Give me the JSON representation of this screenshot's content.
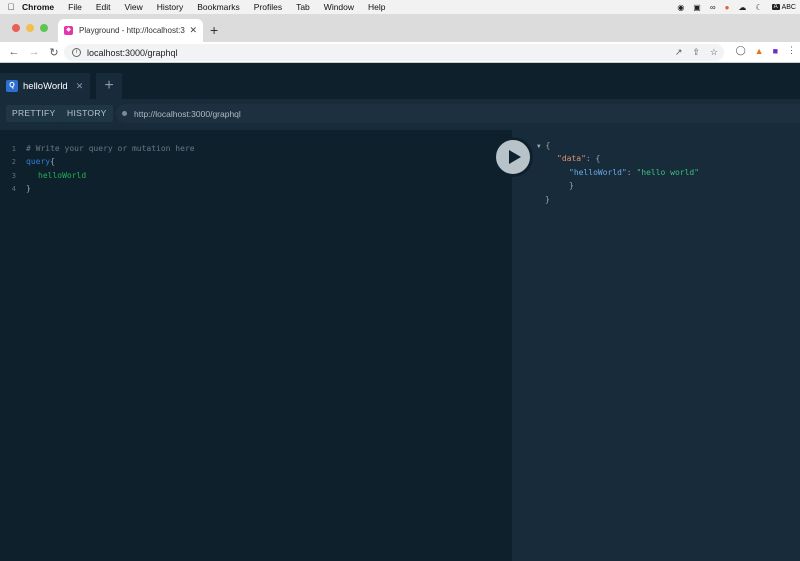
{
  "menubar": {
    "app": "Chrome",
    "items": [
      "File",
      "Edit",
      "View",
      "History",
      "Bookmarks",
      "Profiles",
      "Tab",
      "Window",
      "Help"
    ],
    "input_label": "ABC"
  },
  "browser": {
    "tab_title": "Playground - http://localhost:3",
    "url": "localhost:3000/graphql"
  },
  "playground": {
    "tab_label": "helloWorld",
    "tab_badge": "Q",
    "toolbar": {
      "prettify": "PRETTIFY",
      "history": "HISTORY"
    },
    "endpoint": "http://localhost:3000/graphql",
    "editor": {
      "line_numbers": [
        "1",
        "2",
        "3",
        "4"
      ],
      "comment": "# Write your query or mutation here",
      "keyword": "query",
      "open_brace": "{",
      "field": "helloWorld",
      "close_brace": "}"
    },
    "result": {
      "open": "{",
      "data_key": "\"data\"",
      "colon": ": {",
      "field_key": "\"helloWorld\"",
      "field_colon": ": ",
      "field_value": "\"hello world\"",
      "inner_close": "}",
      "outer_close": "}"
    }
  }
}
